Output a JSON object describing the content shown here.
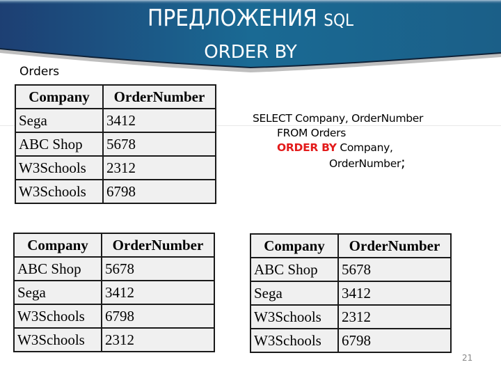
{
  "header": {
    "title_main": "ПРЕДЛОЖЕНИЯ",
    "title_suffix": "SQL",
    "subtitle": "ORDER BY",
    "colors": {
      "banner_left": "#1d3f73",
      "banner_right": "#1b6f92",
      "title_text": "#ffffff"
    }
  },
  "caption": "Orders",
  "tables": [
    {
      "name": "original",
      "headers": [
        "Company",
        "OrderNumber"
      ],
      "rows": [
        [
          "Sega",
          "3412"
        ],
        [
          "ABC Shop",
          "5678"
        ],
        [
          "W3Schools",
          "2312"
        ],
        [
          "W3Schools",
          "6798"
        ]
      ]
    },
    {
      "name": "sorted-variant-a",
      "headers": [
        "Company",
        "OrderNumber"
      ],
      "rows": [
        [
          "ABC Shop",
          "5678"
        ],
        [
          "Sega",
          "3412"
        ],
        [
          "W3Schools",
          "6798"
        ],
        [
          "W3Schools",
          "2312"
        ]
      ]
    },
    {
      "name": "sorted-by-company-ordernumber",
      "headers": [
        "Company",
        "OrderNumber"
      ],
      "rows": [
        [
          "ABC Shop",
          "5678"
        ],
        [
          "Sega",
          "3412"
        ],
        [
          "W3Schools",
          "2312"
        ],
        [
          "W3Schools",
          "6798"
        ]
      ]
    }
  ],
  "sql": {
    "line1": "SELECT Company, OrderNumber",
    "line2": "FROM Orders",
    "line3_keyword": "ORDER BY",
    "line3_rest": " Company,",
    "line4": "OrderNumber",
    "line4_end": ";",
    "keyword_color": "#e31b1b"
  },
  "page_number": "21"
}
